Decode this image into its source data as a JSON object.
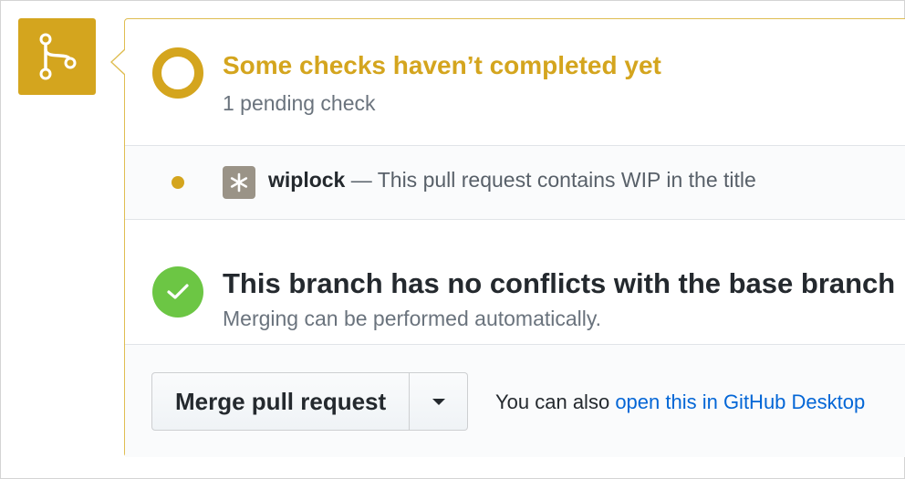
{
  "status": {
    "title": "Some checks haven’t completed yet",
    "subtitle": "1 pending check"
  },
  "check": {
    "app_name": "wiplock",
    "dash": "—",
    "description": "This pull request contains WIP in the title"
  },
  "merge_status": {
    "title": "This branch has no conflicts with the base branch",
    "subtitle": "Merging can be performed automatically."
  },
  "actions": {
    "merge_label": "Merge pull request",
    "also_prefix": "You can also",
    "desktop_link": "open this in GitHub Desktop"
  },
  "colors": {
    "pending": "#d4a51e",
    "success": "#6cc644",
    "link": "#0366d6",
    "app_avatar": "#9a9387"
  },
  "icons": {
    "badge": "git-branch-icon",
    "pending": "pending-ring-icon",
    "check_status": "pending-dot-icon",
    "app": "wiplock-app-icon",
    "success": "checkmark-icon",
    "dropdown": "triangle-down-icon"
  }
}
